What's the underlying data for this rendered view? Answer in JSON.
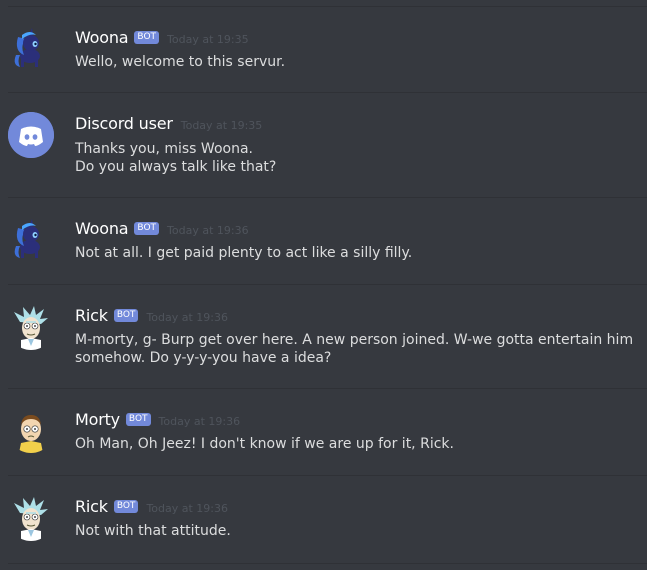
{
  "colors": {
    "background": "#36393f",
    "divider": "#2f3136",
    "username": "#ffffff",
    "message_text": "#dcddde",
    "timestamp": "#4f545c",
    "bot_tag": "#7289da",
    "discord_avatar": "#7289da"
  },
  "messages": [
    {
      "avatar_icon": "woona-pony-avatar",
      "username": "Woona",
      "bot_tag": "BOT",
      "timestamp": "Today at 19:35",
      "lines": [
        "Wello, welcome to this servur."
      ]
    },
    {
      "avatar_icon": "discord-logo-avatar",
      "username": "Discord user",
      "timestamp": "Today at 19:35",
      "lines": [
        "Thanks you, miss Woona.",
        "Do you always talk like that?"
      ]
    },
    {
      "avatar_icon": "woona-pony-avatar",
      "username": "Woona",
      "bot_tag": "BOT",
      "timestamp": "Today at 19:36",
      "lines": [
        "Not at all. I get paid plenty to act like a silly filly."
      ]
    },
    {
      "avatar_icon": "rick-avatar",
      "username": "Rick",
      "bot_tag": "BOT",
      "timestamp": "Today at 19:36",
      "lines": [
        "M-morty, g- Burp get over here. A new person joined. W-we gotta entertain him",
        "somehow. Do y-y-y-you have a idea?"
      ]
    },
    {
      "avatar_icon": "morty-avatar",
      "username": "Morty",
      "bot_tag": "BOT",
      "timestamp": "Today at 19:36",
      "lines": [
        "Oh Man, Oh Jeez! I don't know if we are up for it, Rick."
      ]
    },
    {
      "avatar_icon": "rick-avatar",
      "username": "Rick",
      "bot_tag": "BOT",
      "timestamp": "Today at 19:36",
      "lines": [
        "Not with that attitude."
      ]
    }
  ]
}
